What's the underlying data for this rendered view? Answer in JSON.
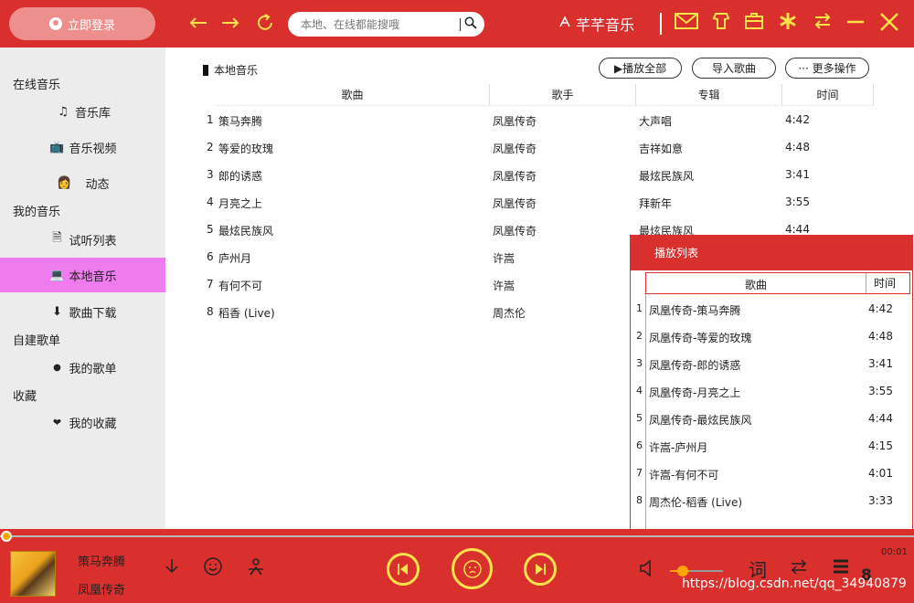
{
  "header": {
    "login_label": "立即登录",
    "search_placeholder": "本地、在线都能搜哦",
    "app_title": "芊芊音乐",
    "icons": [
      "back-arrow-icon",
      "forward-arrow-icon",
      "refresh-icon",
      "mail-icon",
      "skin-icon",
      "briefcase-icon",
      "settings-star-icon",
      "switch-mode-icon",
      "minimize-icon",
      "close-icon"
    ]
  },
  "sidebar": {
    "sections": [
      {
        "label": "在线音乐"
      },
      {
        "label": "我的音乐"
      },
      {
        "label": "自建歌单"
      },
      {
        "label": "收藏"
      }
    ],
    "items": [
      {
        "label": "音乐库",
        "icon": "♫"
      },
      {
        "label": "音乐视频",
        "icon": "📺"
      },
      {
        "label": "动态",
        "icon": "👩"
      },
      {
        "label": "试听列表",
        "icon": "🗎"
      },
      {
        "label": "本地音乐",
        "icon": "💻"
      },
      {
        "label": "歌曲下载",
        "icon": "⬇"
      },
      {
        "label": "我的歌单",
        "icon": "●"
      },
      {
        "label": "我的收藏",
        "icon": "❤"
      }
    ]
  },
  "main": {
    "section_title": "本地音乐",
    "play_all_label": "▶播放全部",
    "import_label": "导入歌曲",
    "more_label": "··· 更多操作",
    "columns": [
      "歌曲",
      "歌手",
      "专辑",
      "时间"
    ],
    "rows": [
      {
        "num": "1",
        "song": "策马奔腾",
        "artist": "凤凰传奇",
        "album": "大声唱",
        "time": "4:42"
      },
      {
        "num": "2",
        "song": "等爱的玫瑰",
        "artist": "凤凰传奇",
        "album": "吉祥如意",
        "time": "4:48"
      },
      {
        "num": "3",
        "song": "郎的诱惑",
        "artist": "凤凰传奇",
        "album": "最炫民族风",
        "time": "3:41"
      },
      {
        "num": "4",
        "song": "月亮之上",
        "artist": "凤凰传奇",
        "album": "拜新年",
        "time": "3:55"
      },
      {
        "num": "5",
        "song": "最炫民族风",
        "artist": "凤凰传奇",
        "album": "最炫民族风",
        "time": "4:44"
      },
      {
        "num": "6",
        "song": "庐州月",
        "artist": "许嵩",
        "album": "",
        "time": ""
      },
      {
        "num": "7",
        "song": "有何不可",
        "artist": "许嵩",
        "album": "",
        "time": ""
      },
      {
        "num": "8",
        "song": "稻香 (Live)",
        "artist": "周杰伦",
        "album": "",
        "time": ""
      }
    ]
  },
  "playlist": {
    "title": "播放列表",
    "col_song": "歌曲",
    "col_time": "时间",
    "items": [
      {
        "num": "1",
        "title": "凤凰传奇-策马奔腾",
        "time": "4:42"
      },
      {
        "num": "2",
        "title": "凤凰传奇-等爱的玫瑰",
        "time": "4:48"
      },
      {
        "num": "3",
        "title": "凤凰传奇-郎的诱惑",
        "time": "3:41"
      },
      {
        "num": "4",
        "title": "凤凰传奇-月亮之上",
        "time": "3:55"
      },
      {
        "num": "5",
        "title": "凤凰传奇-最炫民族风",
        "time": "4:44"
      },
      {
        "num": "6",
        "title": "许嵩-庐州月",
        "time": "4:15"
      },
      {
        "num": "7",
        "title": "许嵩-有何不可",
        "time": "4:01"
      },
      {
        "num": "8",
        "title": "周杰伦-稻香 (Live)",
        "time": "3:33"
      }
    ]
  },
  "player": {
    "song": "策马奔腾",
    "artist": "凤凰传奇",
    "elapsed": "00:01",
    "lyrics_label": "词",
    "playlist_count": "8",
    "volume_level": 0.2,
    "progress": 0.0
  },
  "watermark": "https://blog.csdn.net/qq_34940879",
  "colors": {
    "primary_red": "#d9302e",
    "accent_yellow": "#ffe34a",
    "active_item": "#ef7cee",
    "progress_orange": "#ffa500"
  }
}
